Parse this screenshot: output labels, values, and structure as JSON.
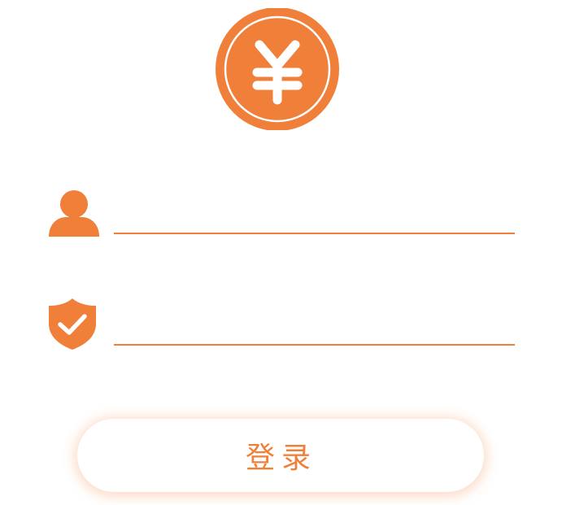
{
  "theme": {
    "accent": "#f07f3a",
    "background": "#ffffff"
  },
  "logo": {
    "icon": "yen-coin-icon",
    "symbol": "¥"
  },
  "form": {
    "username": {
      "icon": "user-icon",
      "value": "",
      "placeholder": ""
    },
    "password": {
      "icon": "shield-check-icon",
      "value": "",
      "placeholder": ""
    },
    "login_label": "登录"
  }
}
